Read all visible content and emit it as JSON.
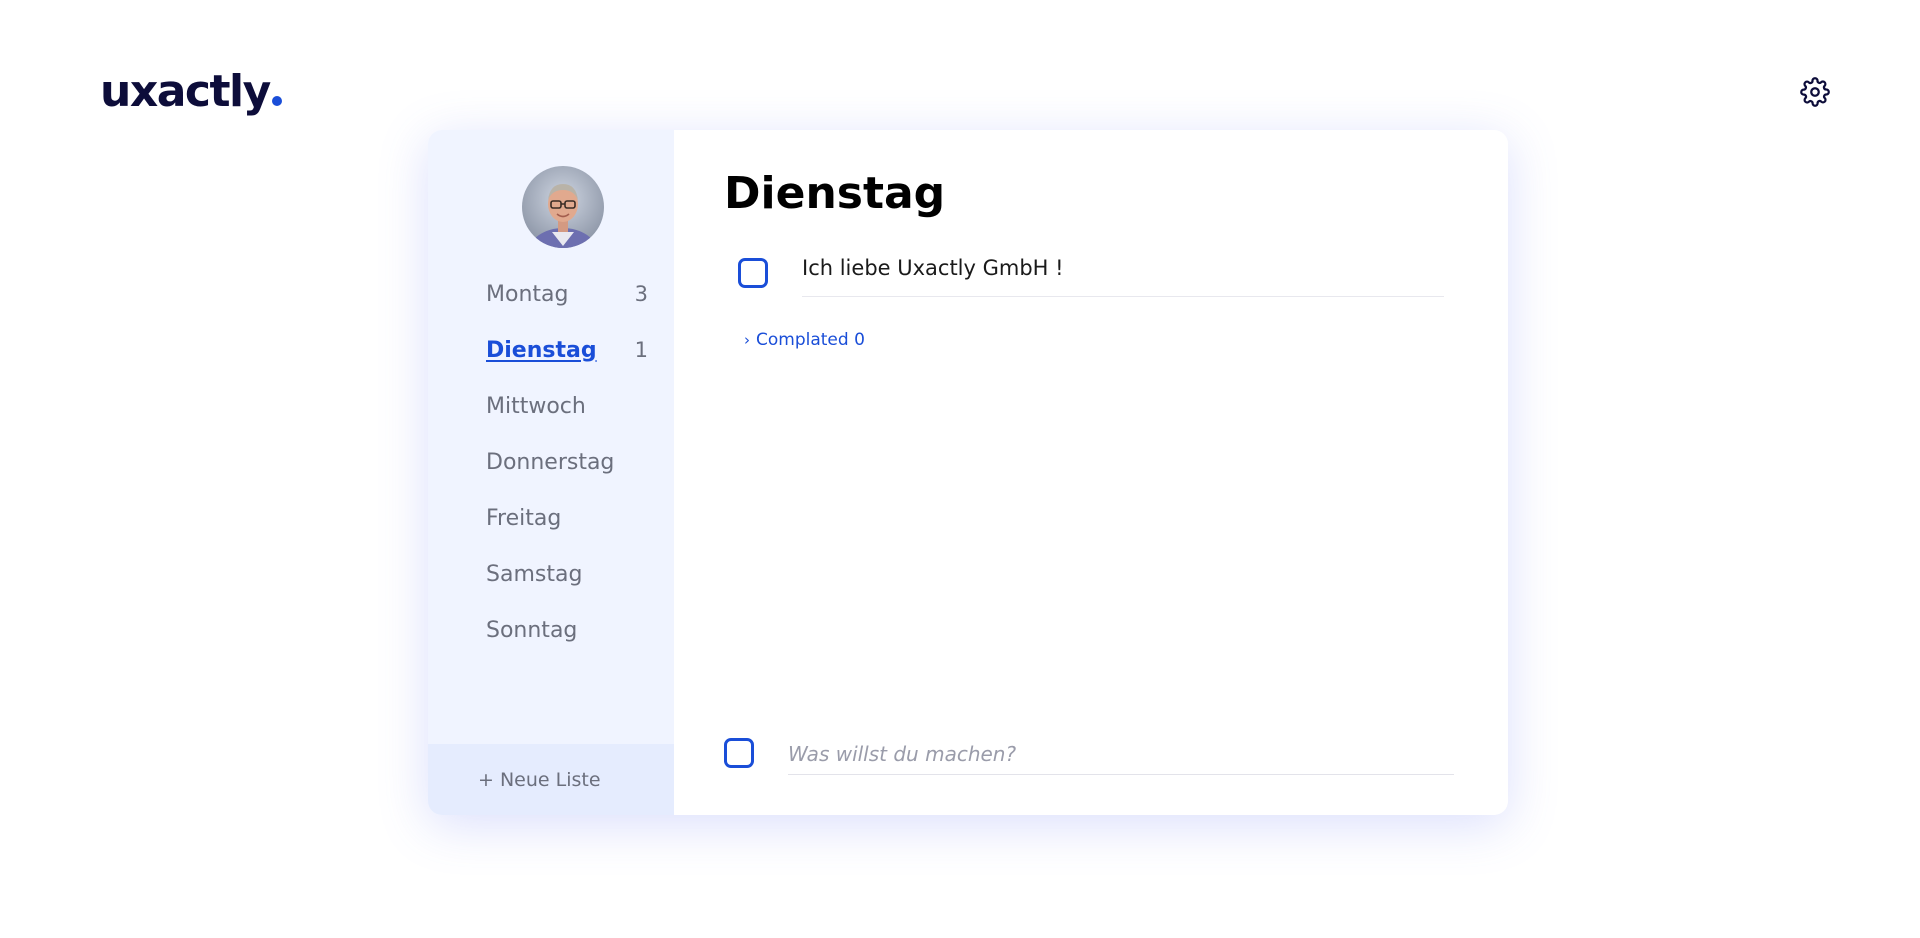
{
  "header": {
    "logo_text": "uxactly",
    "logo_dot_color": "#1a4ed8",
    "settings_icon": "gear-icon"
  },
  "sidebar": {
    "avatar_icon": "user-avatar",
    "items": [
      {
        "label": "Montag",
        "count": "3"
      },
      {
        "label": "Dienstag",
        "count": "1",
        "active": true
      },
      {
        "label": "Mittwoch",
        "count": ""
      },
      {
        "label": "Donnerstag",
        "count": ""
      },
      {
        "label": "Freitag",
        "count": ""
      },
      {
        "label": "Samstag",
        "count": ""
      },
      {
        "label": "Sonntag",
        "count": ""
      }
    ],
    "new_list_label": "+ Neue Liste"
  },
  "main": {
    "title": "Dienstag",
    "tasks": [
      {
        "text": "Ich liebe Uxactly GmbH !",
        "done": false
      }
    ],
    "completed_label": "Complated 0",
    "new_task_placeholder": "Was willst du machen?",
    "new_task_value": ""
  },
  "colors": {
    "accent": "#1a4ed8",
    "sidebar_bg": "#f0f4ff",
    "text_muted": "#6b6f7d"
  }
}
